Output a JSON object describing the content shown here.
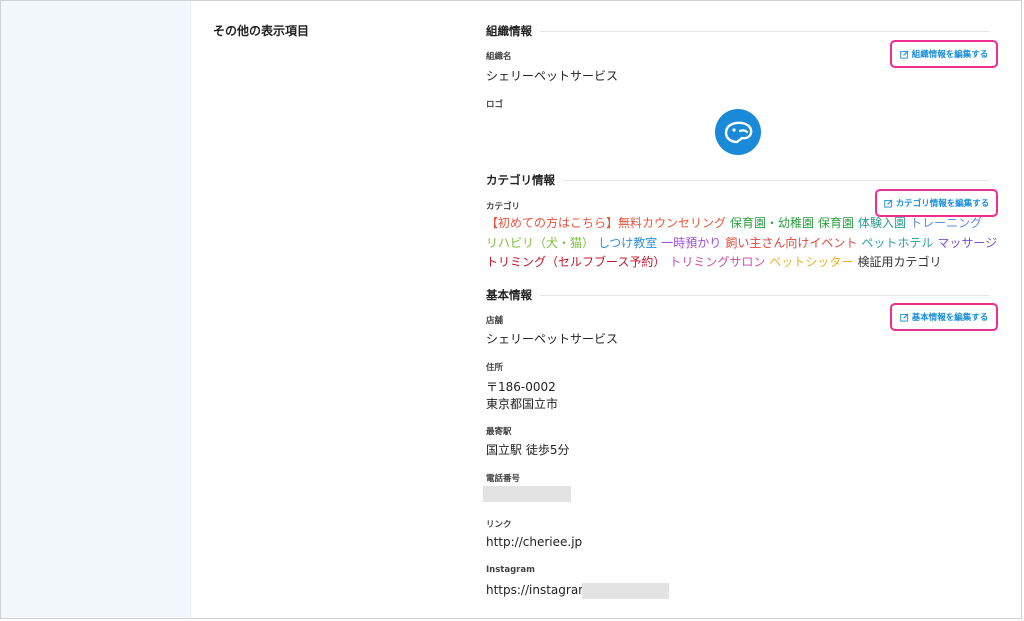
{
  "left_title": "その他の表示項目",
  "org": {
    "heading": "組織情報",
    "name_label": "組織名",
    "name_value": "シェリーペットサービス",
    "logo_label": "ロゴ",
    "edit_label": "組織情報を編集する"
  },
  "category": {
    "heading": "カテゴリ情報",
    "label": "カテゴリ",
    "edit_label": "カテゴリ情報を編集する",
    "line1": [
      {
        "text": "【初めての方はこちら】無料カウンセリング",
        "color": "#e8553e"
      },
      {
        "text": "保育園・幼稚園",
        "color": "#2ea043"
      },
      {
        "text": "保育園",
        "color": "#2ea043"
      },
      {
        "text": "体験入園",
        "color": "#2a9d8f"
      },
      {
        "text": "トレーニング",
        "color": "#5d8be0"
      }
    ],
    "line2": [
      {
        "text": "リハビリ（犬・猫）",
        "color": "#7cbf3a"
      },
      {
        "text": "しつけ教室",
        "color": "#2f8fd6"
      },
      {
        "text": "一時預かり",
        "color": "#a14fd1"
      },
      {
        "text": "飼い主さん向けイベント",
        "color": "#e0463a"
      },
      {
        "text": "ペットホテル",
        "color": "#2ba0a8"
      },
      {
        "text": "マッサージ",
        "color": "#7b52c8"
      }
    ],
    "line3": [
      {
        "text": "トリミング（セルフブース予約）",
        "color": "#c0182e"
      },
      {
        "text": "トリミングサロン",
        "color": "#c156a8"
      },
      {
        "text": "ペットシッター",
        "color": "#e8b22a"
      },
      {
        "text": "検証用カテゴリ",
        "color": "#333333"
      }
    ]
  },
  "basic": {
    "heading": "基本情報",
    "edit_label": "基本情報を編集する",
    "store_label": "店舗",
    "store_value": "シェリーペットサービス",
    "address_label": "住所",
    "postal": "〒186-0002",
    "address": "東京都国立市",
    "station_label": "最寄駅",
    "station_value": "国立駅 徒歩5分",
    "phone_label": "電話番号",
    "link_label": "リンク",
    "link_value": "http://cheriee.jp",
    "instagram_label": "Instagram",
    "instagram_value": "https://instagram/"
  },
  "colors": {
    "accent_link": "#1b8fd8",
    "highlight_border": "#ee2d8f",
    "logo_bg": "#1a8ad8",
    "sidebar_bg": "#f3f8fd"
  },
  "icons": {
    "edit": "edit-icon",
    "logo": "dog-logo-icon"
  }
}
